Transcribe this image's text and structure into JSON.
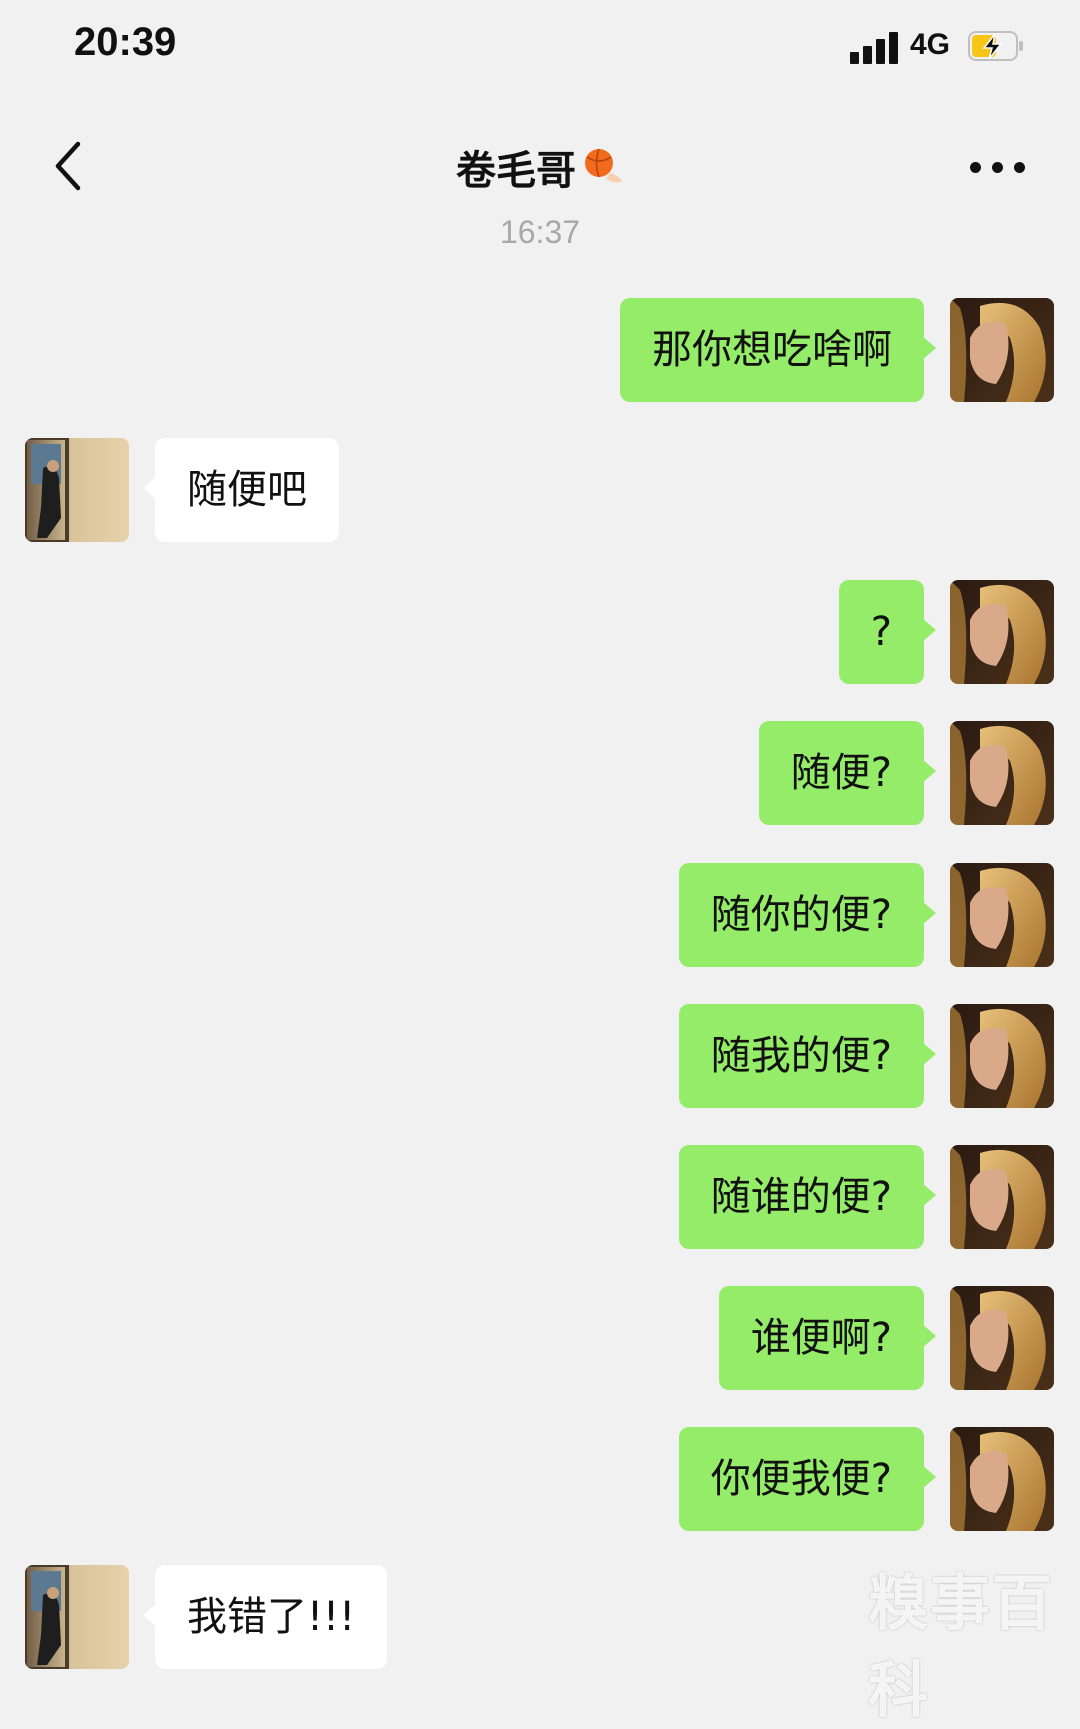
{
  "status_bar": {
    "time": "20:39",
    "network": "4G"
  },
  "header": {
    "title": "卷毛哥",
    "title_emoji": "basketball-emoji"
  },
  "timestamp": "16:37",
  "messages": [
    {
      "side": "me",
      "text": "那你想吃啥啊"
    },
    {
      "side": "other",
      "text": "随便吧"
    },
    {
      "side": "me",
      "text": "?"
    },
    {
      "side": "me",
      "text": "随便?"
    },
    {
      "side": "me",
      "text": "随你的便?"
    },
    {
      "side": "me",
      "text": "随我的便?"
    },
    {
      "side": "me",
      "text": "随谁的便?"
    },
    {
      "side": "me",
      "text": "谁便啊?"
    },
    {
      "side": "me",
      "text": "你便我便?"
    },
    {
      "side": "other",
      "text": "我错了!!!"
    }
  ],
  "watermark": "糗事百科",
  "colors": {
    "bubble_me": "#95ec69",
    "bubble_other": "#ffffff",
    "background": "#f1f1f1"
  },
  "icons": {
    "back": "chevron-left-icon",
    "more": "more-dots-icon",
    "signal": "signal-icon",
    "battery": "battery-charging-icon"
  }
}
